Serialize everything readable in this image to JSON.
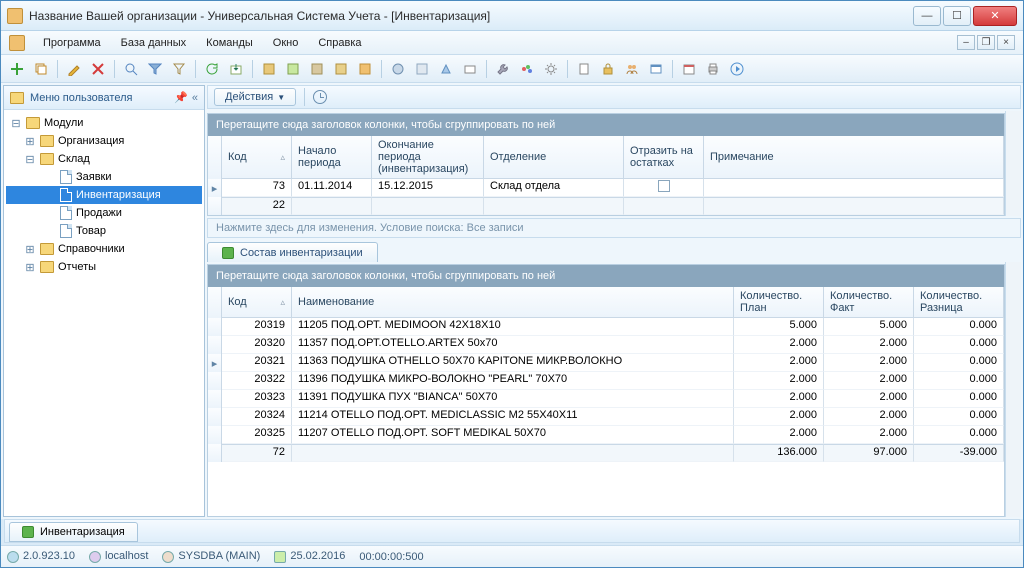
{
  "window": {
    "title": "Название Вашей организации - Универсальная Система Учета - [Инвентаризация]"
  },
  "menu": {
    "items": [
      "Программа",
      "База данных",
      "Команды",
      "Окно",
      "Справка"
    ]
  },
  "sidebar": {
    "title": "Меню пользователя",
    "root": "Модули",
    "org": "Организация",
    "sklad": "Склад",
    "sklad_items": [
      "Заявки",
      "Инвентаризация",
      "Продажи",
      "Товар"
    ],
    "sprav": "Справочники",
    "otch": "Отчеты"
  },
  "actions": {
    "label": "Действия"
  },
  "top_grid": {
    "group_hint": "Перетащите сюда заголовок колонки, чтобы сгруппировать по ней",
    "cols": [
      "Код",
      "Начало периода",
      "Окончание периода (инвентаризация)",
      "Отделение",
      "Отразить на остатках",
      "Примечание"
    ],
    "row": {
      "code": "73",
      "start": "01.11.2014",
      "end": "15.12.2015",
      "dept": "Склад отдела",
      "reflect": "",
      "note": ""
    },
    "sum": "22"
  },
  "search_hint": "Нажмите здесь для изменения. Условие поиска: Все записи",
  "subtab": "Состав инвентаризации",
  "bot_grid": {
    "group_hint": "Перетащите сюда заголовок колонки, чтобы сгруппировать по ней",
    "cols": [
      "Код",
      "Наименование",
      "Количество. План",
      "Количество. Факт",
      "Количество. Разница"
    ],
    "rows": [
      {
        "c": "20319",
        "n": "11205 ПОД.ОРТ. MEDIMOON 42X18X10",
        "p": "5.000",
        "f": "5.000",
        "d": "0.000"
      },
      {
        "c": "20320",
        "n": "11357 ПОД.ОРТ.OTELLO.ARTEX 50x70",
        "p": "2.000",
        "f": "2.000",
        "d": "0.000"
      },
      {
        "c": "20321",
        "n": "11363 ПОДУШКА OTHELLO 50X70 KAPITONE МИКР.ВОЛОКНО",
        "p": "2.000",
        "f": "2.000",
        "d": "0.000"
      },
      {
        "c": "20322",
        "n": "11396 ПОДУШКА МИКРО-ВОЛОКНО \"PEARL\" 70X70",
        "p": "2.000",
        "f": "2.000",
        "d": "0.000"
      },
      {
        "c": "20323",
        "n": "11391 ПОДУШКА ПУХ \"BIANCA\" 50X70",
        "p": "2.000",
        "f": "2.000",
        "d": "0.000"
      },
      {
        "c": "20324",
        "n": "11214 OTELLO ПОД.ОРТ. MEDICLASSIC M2 55X40X11",
        "p": "2.000",
        "f": "2.000",
        "d": "0.000"
      },
      {
        "c": "20325",
        "n": "11207 OTELLO ПОД.ОРТ. SOFT MEDIKAL 50X70",
        "p": "2.000",
        "f": "2.000",
        "d": "0.000"
      }
    ],
    "sum": {
      "count": "72",
      "p": "136.000",
      "f": "97.000",
      "d": "-39.000"
    }
  },
  "bottom_tab": "Инвентаризация",
  "status": {
    "ver": "2.0.923.10",
    "host": "localhost",
    "user": "SYSDBA (MAIN)",
    "date": "25.02.2016",
    "time": "00:00:00:500"
  }
}
